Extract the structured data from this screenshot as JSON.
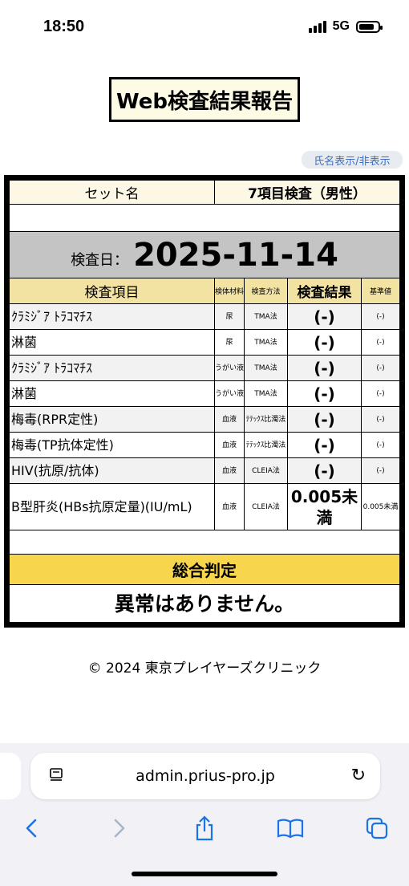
{
  "status_bar": {
    "time": "18:50",
    "network": "5G"
  },
  "page": {
    "title": "Web検査結果報告",
    "name_toggle": "氏名表示/非表示"
  },
  "report": {
    "set_label": "セット名",
    "set_value": "7項目検査（男性）",
    "date_label": "検査日：",
    "date_value": "2025-11-14",
    "headers": {
      "item": "検査項目",
      "specimen": "検体材料",
      "method": "検査方法",
      "result": "検査結果",
      "reference": "基準値"
    },
    "rows": [
      {
        "item": "ｸﾗﾐｼﾞｱ ﾄﾗｺﾏﾁｽ",
        "specimen": "尿",
        "method": "TMA法",
        "result": "(-)",
        "reference": "(-)"
      },
      {
        "item": "淋菌",
        "specimen": "尿",
        "method": "TMA法",
        "result": "(-)",
        "reference": "(-)"
      },
      {
        "item": "ｸﾗﾐｼﾞｱ ﾄﾗｺﾏﾁｽ",
        "specimen": "うがい液",
        "method": "TMA法",
        "result": "(-)",
        "reference": "(-)"
      },
      {
        "item": "淋菌",
        "specimen": "うがい液",
        "method": "TMA法",
        "result": "(-)",
        "reference": "(-)"
      },
      {
        "item": "梅毒(RPR定性)",
        "specimen": "血液",
        "method": "ﾃﾃｯｸｽ比濁法",
        "result": "(-)",
        "reference": "(-)"
      },
      {
        "item": "梅毒(TP抗体定性)",
        "specimen": "血液",
        "method": "ﾃﾃｯｸｽ比濁法",
        "result": "(-)",
        "reference": "(-)"
      },
      {
        "item": "HIV(抗原/抗体)",
        "specimen": "血液",
        "method": "CLEIA法",
        "result": "(-)",
        "reference": "(-)"
      },
      {
        "item": "B型肝炎(HBs抗原定量)(IU/mL)",
        "specimen": "血液",
        "method": "CLEIA法",
        "result": "0.005未満",
        "reference": "0.005未満"
      }
    ],
    "verdict_label": "総合判定",
    "verdict_value": "異常はありません。"
  },
  "footer": "© 2024 東京プレイヤーズクリニック",
  "browser": {
    "url": "admin.prius-pro.jp"
  }
}
